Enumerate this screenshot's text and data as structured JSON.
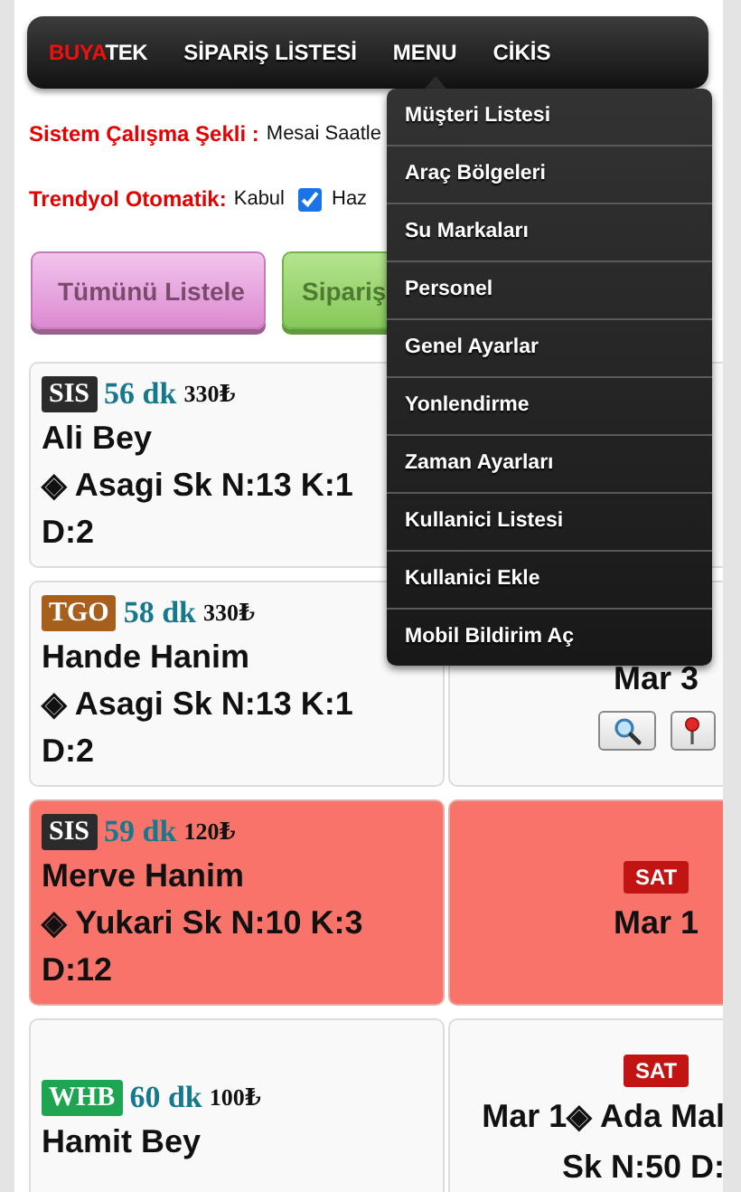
{
  "nav": {
    "brand": [
      {
        "text": "BUYA",
        "kind": "accent"
      },
      {
        "text": "TEK",
        "kind": "plain"
      }
    ],
    "items": [
      "SİPARİŞ LİSTESİ",
      "MENU",
      "CİKİS"
    ]
  },
  "menu": {
    "items": [
      "Müşteri Listesi",
      "Araç Bölgeleri",
      "Su Markaları",
      "Personel",
      "Genel Ayarlar",
      "Yonlendirme",
      "Zaman Ayarları",
      "Kullanici Listesi",
      "Kullanici Ekle",
      "Mobil Bildirim Aç"
    ]
  },
  "settings": [
    {
      "label": "Sistem Çalışma Şekli :",
      "value": "Mesai Saatle"
    },
    {
      "label": "Trendyol Otomatik:",
      "value": "Kabul",
      "checked": true,
      "after": "Haz"
    }
  ],
  "buttons": [
    {
      "label": "Tümünü Listele",
      "kind": "pink"
    },
    {
      "label": "Sipariş",
      "kind": "green"
    }
  ],
  "orders": [
    {
      "source": "SIS",
      "color": "#2b2b2b",
      "minutes": "56 dk",
      "price": "330₺",
      "name": "Ali Bey",
      "address": [
        "◈ Asagi Sk N:13 K:1",
        "D:2"
      ],
      "highlighted": false
    },
    {
      "source": "TGO",
      "color": "#a65f1c",
      "minutes": "58 dk",
      "price": "330₺",
      "name": "Hande Hanim",
      "address": [
        "◈ Asagi Sk N:13 K:1",
        "D:2"
      ],
      "highlighted": false,
      "right": {
        "lines": [
          {
            "text": "Mar 3",
            "kind": "center"
          }
        ],
        "tools": [
          {
            "kind": "search"
          },
          {
            "kind": "pin"
          }
        ]
      }
    },
    {
      "source": "SIS",
      "color": "#2b2b2b",
      "minutes": "59 dk",
      "price": "120₺",
      "name": "Merve Hanim",
      "address": [
        "◈ Yukari Sk N:10 K:3",
        "D:12"
      ],
      "highlighted": true,
      "right": {
        "badge": "SAT",
        "lines": [
          {
            "text": "Mar 1",
            "kind": "center"
          }
        ]
      }
    },
    {
      "source": "WHB",
      "color": "#1ea552",
      "minutes": "60 dk",
      "price": "100₺",
      "name": "Hamit Bey",
      "highlighted": false,
      "right": {
        "badge": "SAT",
        "lines": [
          {
            "text": "Mar 1◈ Ada Mal",
            "kind": "cut"
          },
          {
            "text": "Sk N:50 D:",
            "kind": "cut"
          }
        ]
      }
    }
  ]
}
